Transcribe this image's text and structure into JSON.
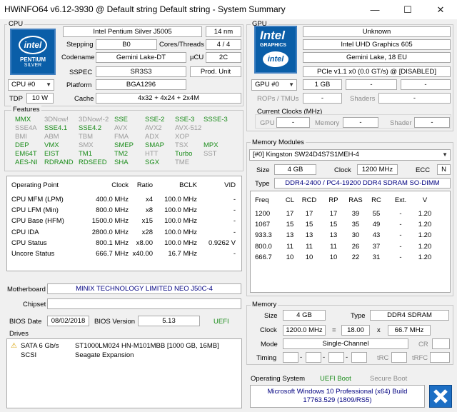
{
  "window": {
    "title": "HWiNFO64 v6.12-3930 @ Default string Default string - System Summary",
    "min": "—",
    "max": "☐",
    "close": "✕"
  },
  "cpu": {
    "section": "CPU",
    "name": "Intel Pentium Silver J5005",
    "nm": "14 nm",
    "stepping_label": "Stepping",
    "stepping": "B0",
    "cores_label": "Cores/Threads",
    "cores": "4 / 4",
    "codename_label": "Codename",
    "codename": "Gemini Lake-DT",
    "ucu_label": "µCU",
    "ucu": "2C",
    "sspec_label": "SSPEC",
    "sspec": "SR3S3",
    "prod": "Prod. Unit",
    "selector": "CPU #0",
    "platform_label": "Platform",
    "platform": "BGA1296",
    "tdp_label": "TDP",
    "tdp": "10 W",
    "cache_label": "Cache",
    "cache": "4x32 + 4x24 + 2x4M",
    "logo": {
      "brand": "intel",
      "line1": "PENTIUM",
      "line2": "SILVER"
    }
  },
  "features": {
    "title": "Features",
    "rows": [
      [
        {
          "t": "MMX",
          "on": true
        },
        {
          "t": "3DNow!",
          "on": false
        },
        {
          "t": "3DNow!-2",
          "on": false
        },
        {
          "t": "SSE",
          "on": true
        },
        {
          "t": "SSE-2",
          "on": true
        },
        {
          "t": "SSE-3",
          "on": true
        },
        {
          "t": "SSSE-3",
          "on": true
        }
      ],
      [
        {
          "t": "SSE4A",
          "on": false
        },
        {
          "t": "SSE4.1",
          "on": true
        },
        {
          "t": "SSE4.2",
          "on": true
        },
        {
          "t": "AVX",
          "on": false
        },
        {
          "t": "AVX2",
          "on": false
        },
        {
          "t": "AVX-512",
          "on": false
        }
      ],
      [
        {
          "t": "BMI",
          "on": false
        },
        {
          "t": "ABM",
          "on": false
        },
        {
          "t": "TBM",
          "on": false
        },
        {
          "t": "FMA",
          "on": false
        },
        {
          "t": "ADX",
          "on": false
        },
        {
          "t": "XOP",
          "on": false
        }
      ],
      [
        {
          "t": "DEP",
          "on": true
        },
        {
          "t": "VMX",
          "on": true
        },
        {
          "t": "SMX",
          "on": false
        },
        {
          "t": "SMEP",
          "on": true
        },
        {
          "t": "SMAP",
          "on": true
        },
        {
          "t": "TSX",
          "on": false
        },
        {
          "t": "MPX",
          "on": true
        }
      ],
      [
        {
          "t": "EM64T",
          "on": true
        },
        {
          "t": "EIST",
          "on": true
        },
        {
          "t": "TM1",
          "on": true
        },
        {
          "t": "TM2",
          "on": true
        },
        {
          "t": "HTT",
          "on": false
        },
        {
          "t": "Turbo",
          "on": true
        },
        {
          "t": "SST",
          "on": false
        }
      ],
      [
        {
          "t": "AES-NI",
          "on": true
        },
        {
          "t": "RDRAND",
          "on": true
        },
        {
          "t": "RDSEED",
          "on": true
        },
        {
          "t": "SHA",
          "on": true
        },
        {
          "t": "SGX",
          "on": true
        },
        {
          "t": "TME",
          "on": false
        }
      ]
    ]
  },
  "op": {
    "headers": [
      "Operating Point",
      "Clock",
      "Ratio",
      "BCLK",
      "VID"
    ],
    "rows": [
      [
        "CPU MFM (LPM)",
        "400.0 MHz",
        "x4",
        "100.0 MHz",
        "-"
      ],
      [
        "CPU LFM (Min)",
        "800.0 MHz",
        "x8",
        "100.0 MHz",
        "-"
      ],
      [
        "CPU Base (HFM)",
        "1500.0 MHz",
        "x15",
        "100.0 MHz",
        "-"
      ],
      [
        "CPU IDA",
        "2800.0 MHz",
        "x28",
        "100.0 MHz",
        "-"
      ],
      [
        "CPU Status",
        "800.1 MHz",
        "x8.00",
        "100.0 MHz",
        "0.9262 V"
      ],
      [
        "Uncore Status",
        "666.7 MHz",
        "x40.00",
        "16.7 MHz",
        "-"
      ]
    ]
  },
  "mb": {
    "label": "Motherboard",
    "value": "MINIX TECHNOLOGY LIMITED NEO J50C-4",
    "chipset_label": "Chipset",
    "chipset": "",
    "bios_date_label": "BIOS Date",
    "bios_date": "08/02/2018",
    "bios_ver_label": "BIOS Version",
    "bios_ver": "5.13",
    "uefi": "UEFI"
  },
  "drives": {
    "title": "Drives",
    "rows": [
      {
        "iface": "SATA 6 Gb/s",
        "model": "ST1000LM024 HN-M101MBB [1000 GB, 16MB]",
        "warn": true
      },
      {
        "iface": "SCSI",
        "model": "Seagate Expansion",
        "warn": false
      }
    ]
  },
  "gpu": {
    "section": "GPU",
    "name": "Unknown",
    "model": "Intel UHD Graphics 605",
    "core": "Gemini Lake, 18 EU",
    "bus": "PCIe v1.1 x0 (0.0 GT/s) @ [DISABLED]",
    "selector": "GPU #0",
    "mem": "1 GB",
    "f1": "-",
    "f2": "-",
    "rops_label": "ROPs / TMUs",
    "rops": "-",
    "shaders_label": "Shaders",
    "shaders": "-",
    "clocks_title": "Current Clocks (MHz)",
    "gpu_label": "GPU",
    "gpu_clk": "-",
    "memory_label": "Memory",
    "mem_clk": "-",
    "shader_label": "Shader",
    "shader_clk": "-",
    "logo": {
      "brand": "Intel",
      "line1": "GRAPHICS",
      "badge": "intel"
    }
  },
  "memmod": {
    "title": "Memory Modules",
    "selected": "[#0] Kingston SW24D4S7S1MEH-4",
    "size_label": "Size",
    "size": "4 GB",
    "clock_label": "Clock",
    "clock": "1200 MHz",
    "ecc_label": "ECC",
    "ecc": "N",
    "type_label": "Type",
    "type": "DDR4-2400 / PC4-19200 DDR4 SDRAM SO-DIMM",
    "headers": [
      "Freq",
      "CL",
      "RCD",
      "RP",
      "RAS",
      "RC",
      "Ext.",
      "V"
    ],
    "rows": [
      [
        "1200",
        "17",
        "17",
        "17",
        "39",
        "55",
        "-",
        "1.20"
      ],
      [
        "1067",
        "15",
        "15",
        "15",
        "35",
        "49",
        "-",
        "1.20"
      ],
      [
        "933.3",
        "13",
        "13",
        "13",
        "30",
        "43",
        "-",
        "1.20"
      ],
      [
        "800.0",
        "11",
        "11",
        "11",
        "26",
        "37",
        "-",
        "1.20"
      ],
      [
        "666.7",
        "10",
        "10",
        "10",
        "22",
        "31",
        "-",
        "1.20"
      ]
    ]
  },
  "memory": {
    "title": "Memory",
    "size_label": "Size",
    "size": "4 GB",
    "type_label": "Type",
    "type": "DDR4 SDRAM",
    "clock_label": "Clock",
    "clock": "1200.0 MHz",
    "eq": "=",
    "mult": "18.00",
    "x": "x",
    "base": "66.7 MHz",
    "mode_label": "Mode",
    "mode": "Single-Channel",
    "cr_label": "CR",
    "cr": "",
    "timing_label": "Timing",
    "t1": "",
    "t2": "",
    "t3": "",
    "t4": "",
    "trc_label": "tRC",
    "trc": "",
    "trfc_label": "tRFC",
    "trfc": ""
  },
  "os": {
    "label": "Operating System",
    "boot": "UEFI Boot",
    "secure": "Secure Boot",
    "line1": "Microsoft Windows 10 Professional (x64) Build",
    "line2": "17763.529 (1809/RS5)"
  },
  "colors": {
    "feature_on": "#1a8c1a",
    "feature_off": "#9a9a9a",
    "value_blue": "#000080",
    "os_green": "#1a8c1a",
    "intel_blue": "#0a5ea8"
  }
}
